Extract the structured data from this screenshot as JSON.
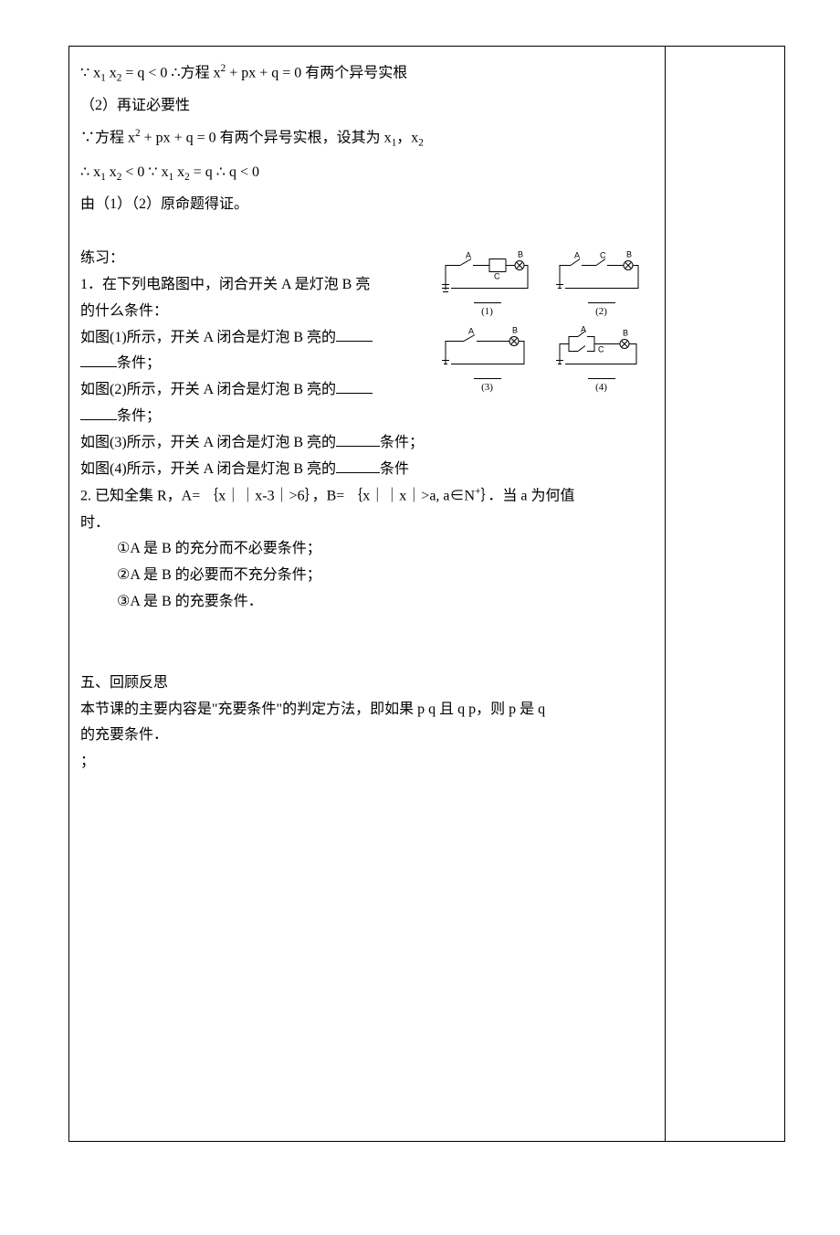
{
  "proof": {
    "line1_pre": "∵ x",
    "line1_sub1": "1",
    "line1_mid1": " x",
    "line1_sub2": "2",
    "line1_mid2": " = q < 0 ∴方程 x",
    "line1_sup1": "2",
    "line1_mid3": " + px + q = 0 有两个异号实根",
    "line2": "（2）再证必要性",
    "line3_pre": "∵方程 x",
    "line3_sup1": "2",
    "line3_mid1": " + px + q = 0 有两个异号实根，设其为 x",
    "line3_sub1": "1",
    "line3_mid2": "，x",
    "line3_sub2": "2",
    "line4_pre": "∴ x",
    "line4_sub1": "1",
    "line4_mid1": " x",
    "line4_sub2": "2",
    "line4_mid2": " < 0 ∵ x",
    "line4_sub3": "1",
    "line4_mid3": " x",
    "line4_sub4": "2",
    "line4_mid4": " = q ∴ q < 0",
    "line5": "由（1）（2）原命题得证。"
  },
  "practice": {
    "title": "练习：",
    "q1_l1": "1．在下列电路图中，闭合开关 A 是灯泡 B 亮",
    "q1_l2": "的什么条件：",
    "q1_c1a": "如图(1)所示，开关 A 闭合是灯泡 B 亮的",
    "q1_c1b": "条件；",
    "q1_c2a": "如图(2)所示，开关 A 闭合是灯泡 B 亮的",
    "q1_c2b": "条件；",
    "q1_c3a": "如图(3)所示，开关 A 闭合是灯泡 B 亮的",
    "q1_c3b": "条件；",
    "q1_c4a": "如图(4)所示，开关 A 闭合是灯泡 B 亮的",
    "q1_c4b": "条件",
    "q2_l1_a": "2. 已知全集 R，A= ｛x｜｜x-3｜>6｝，B= ｛x｜｜x｜>a, a∈N",
    "q2_l1_plus": "+",
    "q2_l1_b": "｝．当 a 为何值",
    "q2_l2": "时．",
    "q2_s1": "①A 是 B 的充分而不必要条件；",
    "q2_s2": "②A 是 B 的必要而不充分条件；",
    "q2_s3": "③A 是 B 的充要条件．"
  },
  "circuits": {
    "c1": "(1)",
    "c2": "(2)",
    "c3": "(3)",
    "c4": "(4)",
    "labelA": "A",
    "labelB": "B",
    "labelC": "C"
  },
  "review": {
    "title": "五、回顾反思",
    "body1": "本节课的主要内容是\"充要条件\"的判定方法，即如果 p  q 且 q  p，则 p 是 q",
    "body2": "的充要条件．",
    "body3": "；"
  }
}
